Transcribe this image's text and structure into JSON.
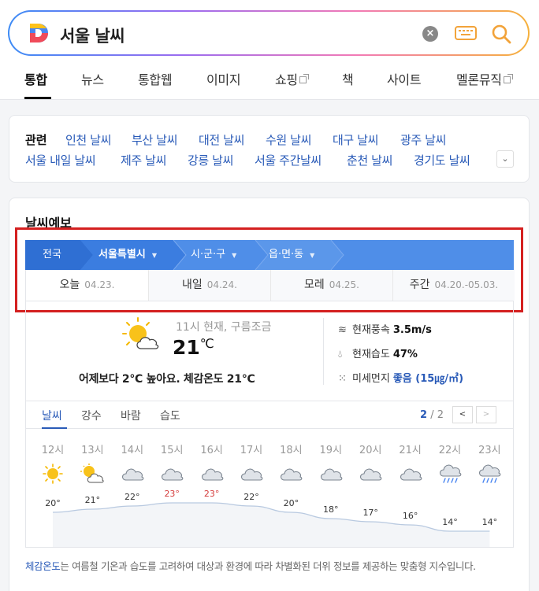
{
  "search": {
    "query": "서울 날씨"
  },
  "tabs": [
    {
      "label": "통합",
      "active": true
    },
    {
      "label": "뉴스"
    },
    {
      "label": "통합웹"
    },
    {
      "label": "이미지"
    },
    {
      "label": "쇼핑",
      "external": true
    },
    {
      "label": "책"
    },
    {
      "label": "사이트"
    },
    {
      "label": "멜론뮤직",
      "external": true
    }
  ],
  "related": {
    "title": "관련",
    "links": [
      "인천 날씨",
      "부산 날씨",
      "대전 날씨",
      "수원 날씨",
      "대구 날씨",
      "광주 날씨",
      "서울 내일 날씨",
      "제주 날씨",
      "강릉 날씨",
      "서울 주간날씨",
      "춘천 날씨",
      "경기도 날씨"
    ],
    "more": "⌄"
  },
  "weather": {
    "title": "날씨예보",
    "location": [
      "전국",
      "서울특별시",
      "시·군·구",
      "읍·면·동"
    ],
    "date_tabs": [
      {
        "label": "오늘",
        "date": "04.23.",
        "active": true
      },
      {
        "label": "내일",
        "date": "04.24."
      },
      {
        "label": "모레",
        "date": "04.25."
      },
      {
        "label": "주간",
        "date": "04.20.-05.03."
      }
    ],
    "current": {
      "icon": "partly-cloudy-icon",
      "time": "11시 현재, 구름조금",
      "temp": "21",
      "unit": "℃",
      "compare": "어제보다 2°C 높아요.  체감온도 21℃",
      "wind_label": "현재풍속",
      "wind": "3.5m/s",
      "humidity_label": "현재습도",
      "humidity": "47%",
      "dust_label": "미세먼지",
      "dust": "좋음 (15㎍/㎥)"
    },
    "sub_tabs": [
      "날씨",
      "강수",
      "바람",
      "습도"
    ],
    "pager": {
      "current": "2",
      "total": "/ 2"
    },
    "hourly": [
      {
        "hour": "12시",
        "icon": "sun-icon",
        "temp": "20°",
        "t": 20
      },
      {
        "hour": "13시",
        "icon": "partly-cloudy-icon",
        "temp": "21°",
        "t": 21
      },
      {
        "hour": "14시",
        "icon": "cloud-icon",
        "temp": "22°",
        "t": 22
      },
      {
        "hour": "15시",
        "icon": "cloud-icon",
        "temp": "23°",
        "t": 23,
        "hot": true
      },
      {
        "hour": "16시",
        "icon": "cloud-icon",
        "temp": "23°",
        "t": 23,
        "hot": true
      },
      {
        "hour": "17시",
        "icon": "cloud-icon",
        "temp": "22°",
        "t": 22
      },
      {
        "hour": "18시",
        "icon": "cloud-icon",
        "temp": "20°",
        "t": 20
      },
      {
        "hour": "19시",
        "icon": "cloud-icon",
        "temp": "18°",
        "t": 18
      },
      {
        "hour": "20시",
        "icon": "cloud-icon",
        "temp": "17°",
        "t": 17
      },
      {
        "hour": "21시",
        "icon": "cloud-icon",
        "temp": "16°",
        "t": 16
      },
      {
        "hour": "22시",
        "icon": "rain-icon",
        "temp": "14°",
        "t": 14
      },
      {
        "hour": "23시",
        "icon": "rain-icon",
        "temp": "14°",
        "t": 14
      }
    ],
    "footnote_term": "체감온도",
    "footnote": "는 여름철 기온과 습도를 고려하여 대상과 환경에 따라 차별화된 더위 정보를 제공하는 맞춤형 지수입니다."
  }
}
